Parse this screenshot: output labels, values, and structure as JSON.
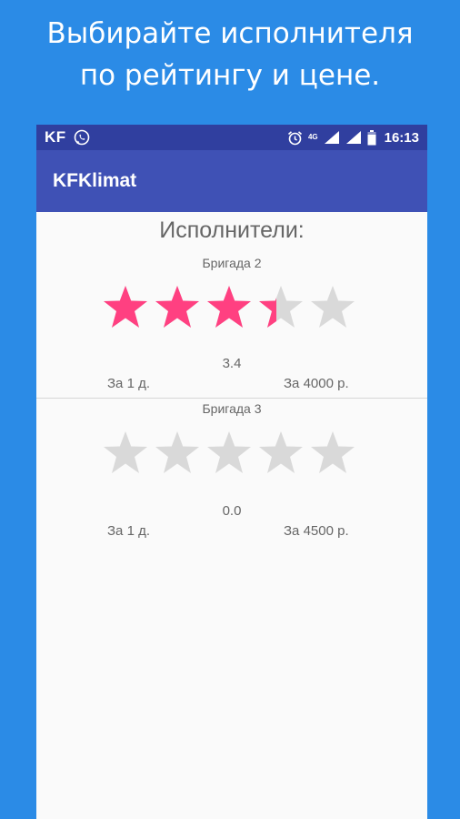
{
  "promo": {
    "line1": "Выбирайте исполнителя",
    "line2": "по рейтингу и цене."
  },
  "status_bar": {
    "carrier": "KF",
    "network": "4G",
    "time": "16:13",
    "icons": [
      "whatsapp-icon",
      "alarm-icon",
      "signal-icon",
      "signal-icon",
      "battery-icon"
    ]
  },
  "app_bar": {
    "title": "KFKlimat"
  },
  "content": {
    "title": "Исполнители:",
    "brigades": [
      {
        "name": "Бригада 2",
        "rating": 3.4,
        "rating_label": "3.4",
        "days": "За 1 д.",
        "price": "За 4000 р."
      },
      {
        "name": "Бригада 3",
        "rating": 0.0,
        "rating_label": "0.0",
        "days": "За 1 д.",
        "price": "За 4500 р."
      }
    ]
  },
  "colors": {
    "background": "#2b8be6",
    "status_bar": "#303f9f",
    "app_bar": "#3f51b5",
    "star_filled": "#ff4081",
    "star_empty": "#d9d9d9",
    "text": "#666666"
  }
}
